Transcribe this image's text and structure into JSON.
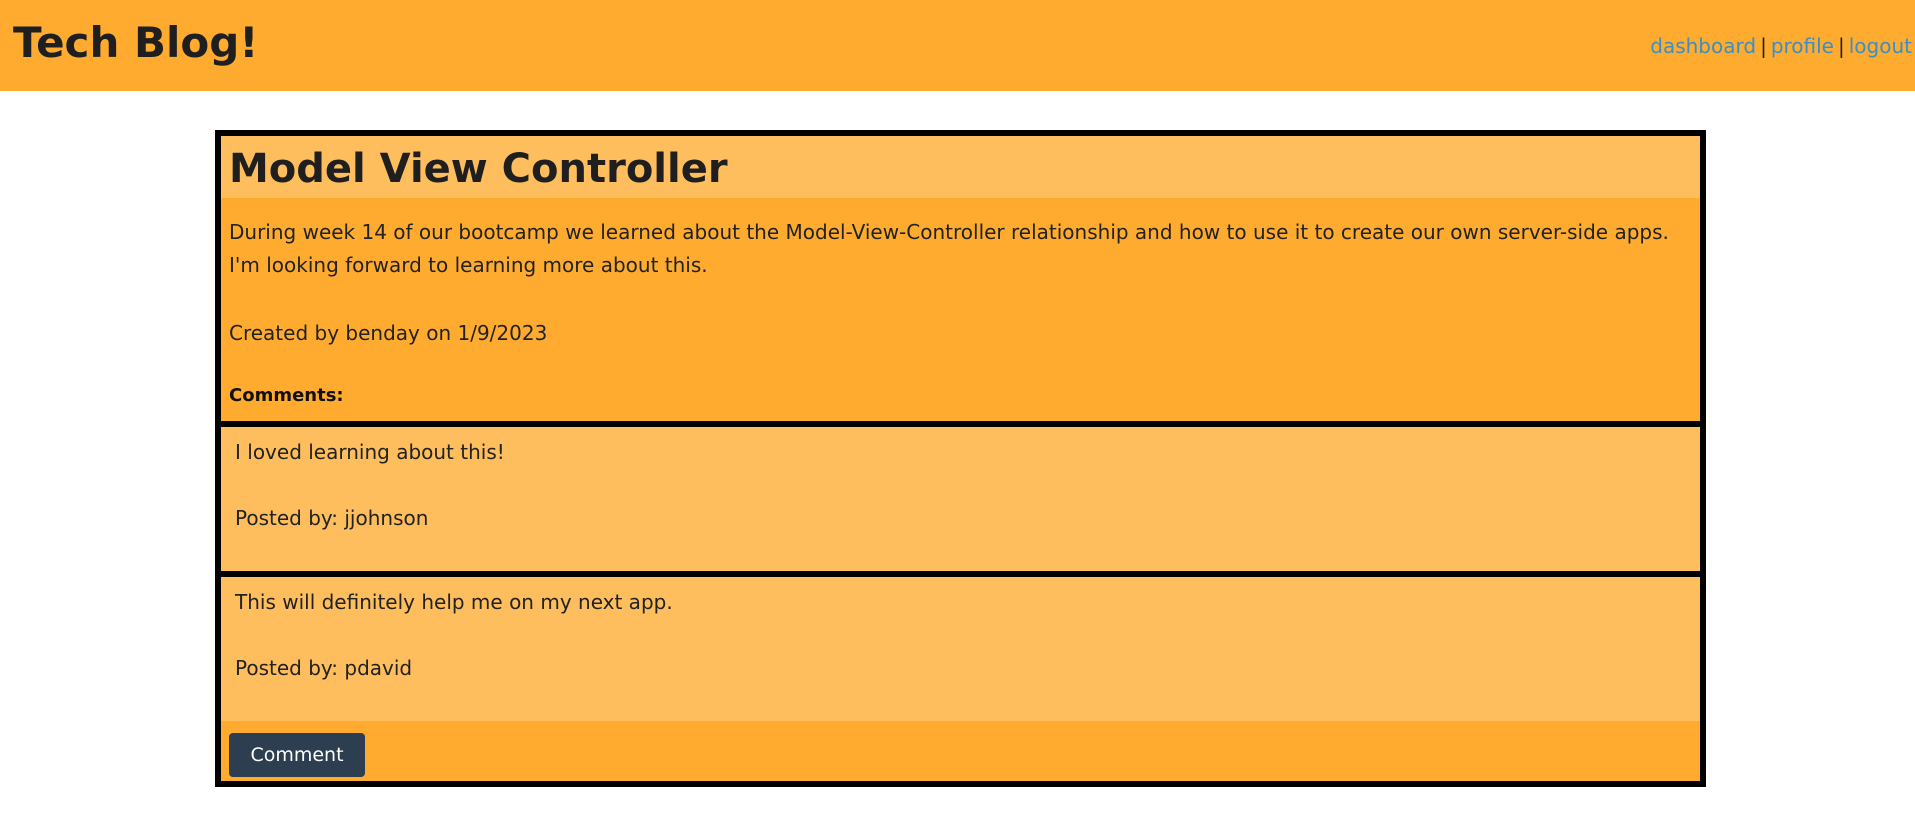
{
  "header": {
    "title": "Tech Blog!",
    "nav": {
      "dashboard": "dashboard",
      "profile": "profile",
      "logout": "logout",
      "separator": "|"
    }
  },
  "post": {
    "title": "Model View Controller",
    "content": "During week 14 of our bootcamp we learned about the Model-View-Controller relationship and how to use it to create our own server-side apps. I'm looking forward to learning more about this.",
    "meta": "Created by benday on 1/9/2023",
    "comments_label": "Comments:"
  },
  "comments": [
    {
      "text": "I loved learning about this!",
      "author": "Posted by: jjohnson"
    },
    {
      "text": "This will definitely help me on my next app.",
      "author": "Posted by: pdavid"
    }
  ],
  "actions": {
    "comment_button": "Comment"
  },
  "colors": {
    "header_bg": "#ffab30",
    "panel_light": "#ffbe5e",
    "link": "#3b8fc4",
    "button_bg": "#2c3e50"
  }
}
